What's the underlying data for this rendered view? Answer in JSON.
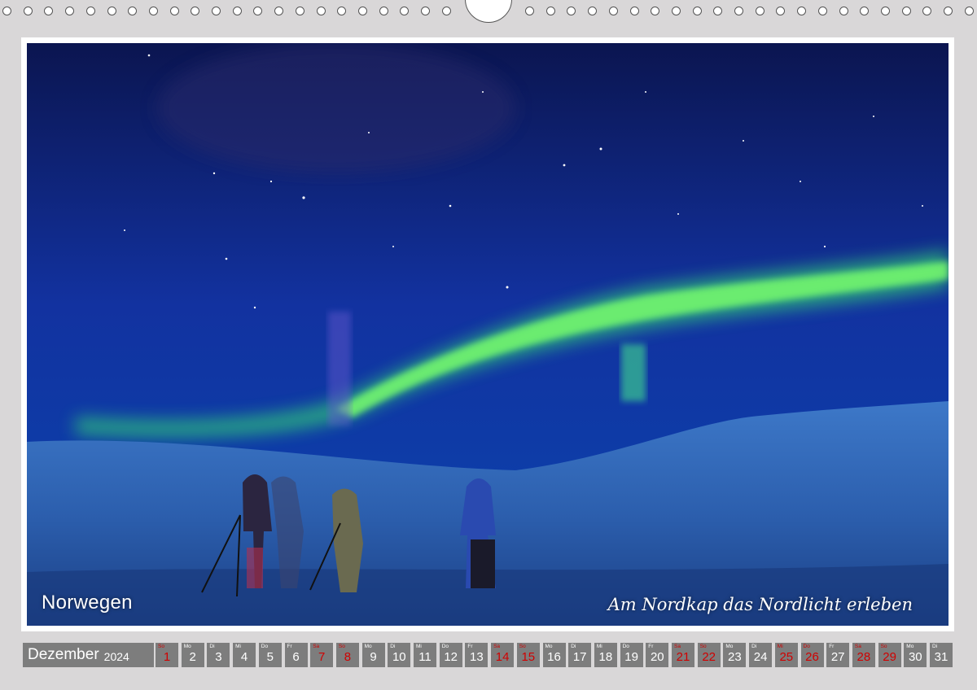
{
  "photo": {
    "caption_left": "Norwegen",
    "caption_right": "Am Nordkap das Nordlicht erleben",
    "description_icon": "aurora-photo"
  },
  "calendar": {
    "month": "Dezember",
    "year": "2024",
    "days": [
      {
        "wd": "So",
        "n": "1",
        "red": true
      },
      {
        "wd": "Mo",
        "n": "2",
        "red": false
      },
      {
        "wd": "Di",
        "n": "3",
        "red": false
      },
      {
        "wd": "Mi",
        "n": "4",
        "red": false
      },
      {
        "wd": "Do",
        "n": "5",
        "red": false
      },
      {
        "wd": "Fr",
        "n": "6",
        "red": false
      },
      {
        "wd": "Sa",
        "n": "7",
        "red": true
      },
      {
        "wd": "So",
        "n": "8",
        "red": true
      },
      {
        "wd": "Mo",
        "n": "9",
        "red": false
      },
      {
        "wd": "Di",
        "n": "10",
        "red": false
      },
      {
        "wd": "Mi",
        "n": "11",
        "red": false
      },
      {
        "wd": "Do",
        "n": "12",
        "red": false
      },
      {
        "wd": "Fr",
        "n": "13",
        "red": false
      },
      {
        "wd": "Sa",
        "n": "14",
        "red": true
      },
      {
        "wd": "So",
        "n": "15",
        "red": true
      },
      {
        "wd": "Mo",
        "n": "16",
        "red": false
      },
      {
        "wd": "Di",
        "n": "17",
        "red": false
      },
      {
        "wd": "Mi",
        "n": "18",
        "red": false
      },
      {
        "wd": "Do",
        "n": "19",
        "red": false
      },
      {
        "wd": "Fr",
        "n": "20",
        "red": false
      },
      {
        "wd": "Sa",
        "n": "21",
        "red": true
      },
      {
        "wd": "So",
        "n": "22",
        "red": true
      },
      {
        "wd": "Mo",
        "n": "23",
        "red": false
      },
      {
        "wd": "Di",
        "n": "24",
        "red": false
      },
      {
        "wd": "Mi",
        "n": "25",
        "red": true
      },
      {
        "wd": "Do",
        "n": "26",
        "red": true
      },
      {
        "wd": "Fr",
        "n": "27",
        "red": false
      },
      {
        "wd": "Sa",
        "n": "28",
        "red": true
      },
      {
        "wd": "So",
        "n": "29",
        "red": true
      },
      {
        "wd": "Mo",
        "n": "30",
        "red": false
      },
      {
        "wd": "Di",
        "n": "31",
        "red": false
      }
    ]
  },
  "colors": {
    "background": "#d9d7d8",
    "strip": "#7d7d7d",
    "holiday": "#d00000"
  }
}
